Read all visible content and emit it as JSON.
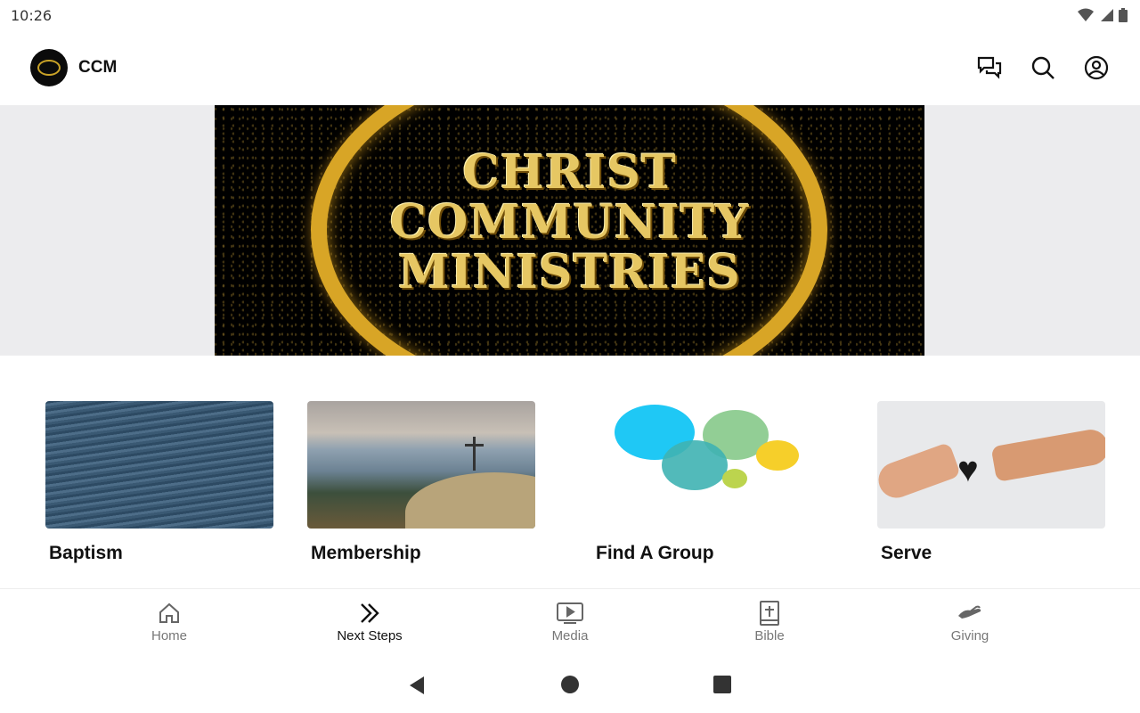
{
  "status": {
    "time": "10:26"
  },
  "app": {
    "title": "CCM"
  },
  "banner": {
    "line1": "CHRIST",
    "line2": "COMMUNITY",
    "line3": "MINISTRIES"
  },
  "cards": [
    {
      "label": "Baptism"
    },
    {
      "label": "Membership"
    },
    {
      "label": "Find A Group"
    },
    {
      "label": "Serve"
    }
  ],
  "nav": [
    {
      "label": "Home",
      "icon": "home-icon"
    },
    {
      "label": "Next Steps",
      "icon": "double-chevron-icon"
    },
    {
      "label": "Media",
      "icon": "play-screen-icon"
    },
    {
      "label": "Bible",
      "icon": "bible-icon"
    },
    {
      "label": "Giving",
      "icon": "giving-hand-icon"
    }
  ],
  "colors": {
    "accent": "#d8a526",
    "hero_bg": "#ececee",
    "active": "#111111",
    "inactive": "#777777"
  }
}
